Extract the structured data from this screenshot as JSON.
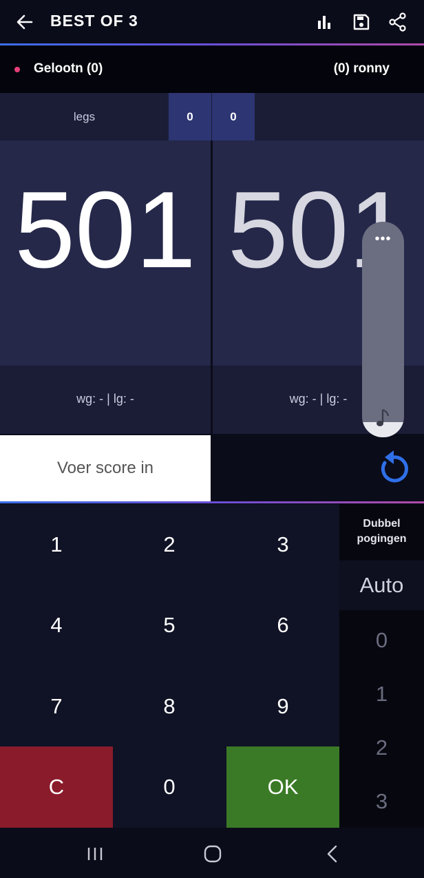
{
  "appbar": {
    "title": "BEST OF 3",
    "icons": [
      "back-arrow-icon",
      "stats-icon",
      "save-icon",
      "share-icon"
    ]
  },
  "players": {
    "left": "Gelootn (0)",
    "right": "(0) ronny",
    "active_color": "#e8407a"
  },
  "legs": {
    "label": "legs",
    "left": "0",
    "right": "0"
  },
  "scores": {
    "left": "501",
    "right": "501",
    "left_stats": "wg: -  |  lg: -",
    "right_stats": "wg: -  |  lg: -"
  },
  "input": {
    "placeholder": "Voer score in"
  },
  "keypad": {
    "keys": [
      "1",
      "2",
      "3",
      "4",
      "5",
      "6",
      "7",
      "8",
      "9",
      "C",
      "0",
      "OK"
    ],
    "clear_color": "#8a1b2a",
    "ok_color": "#3a7a26"
  },
  "side": {
    "label_line1": "Dubbel",
    "label_line2": "pogingen",
    "selected": "Auto",
    "options": [
      "0",
      "1",
      "2",
      "3"
    ]
  },
  "volume": {
    "more": "•••",
    "level": 0.07
  },
  "theme": {
    "accent_start": "#3a6ee8",
    "accent_end": "#b04aa8"
  }
}
